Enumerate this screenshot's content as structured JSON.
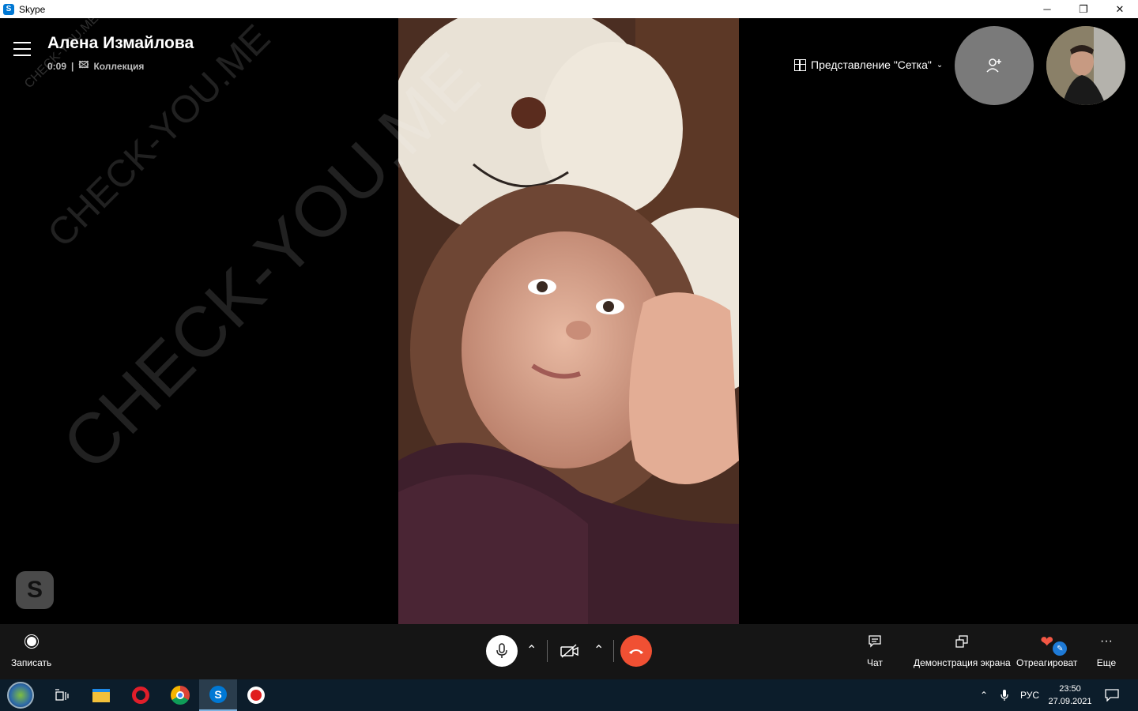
{
  "window": {
    "title": "Skype",
    "minimize_glyph": "─",
    "restore_glyph": "❐",
    "close_glyph": "✕"
  },
  "call": {
    "contact_name": "Алена Измайлова",
    "duration": "0:09",
    "collection_label": "Коллекция",
    "view_mode_label": "Представление \"Сетка\"",
    "watermark_text": "CHECK-YOU.ME"
  },
  "controls": {
    "record_label": "Записать",
    "chat_label": "Чат",
    "screen_share_label": "Демонстрация экрана",
    "react_label": "Отреагироват",
    "more_label": "Еще"
  },
  "taskbar": {
    "language": "РУС",
    "time": "23:50",
    "date": "27.09.2021"
  },
  "colors": {
    "end_call": "#f05033",
    "accent": "#0078d4",
    "controls_bg": "#151515",
    "taskbar_bg": "#0c1d2b"
  }
}
